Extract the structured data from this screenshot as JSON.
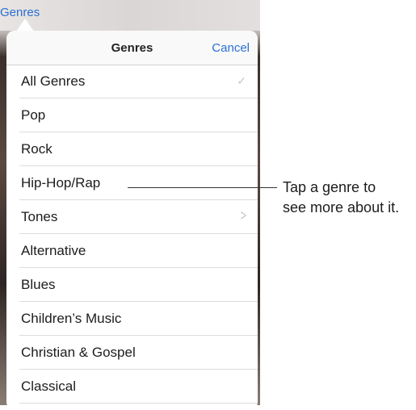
{
  "top_link": "Genres",
  "popover": {
    "title": "Genres",
    "cancel": "Cancel",
    "rows": [
      {
        "label": "All Genres",
        "accessory": "check"
      },
      {
        "label": "Pop",
        "accessory": ""
      },
      {
        "label": "Rock",
        "accessory": ""
      },
      {
        "label": "Hip-Hop/Rap",
        "accessory": ""
      },
      {
        "label": "Tones",
        "accessory": "chevron"
      },
      {
        "label": "Alternative",
        "accessory": ""
      },
      {
        "label": "Blues",
        "accessory": ""
      },
      {
        "label": "Children’s Music",
        "accessory": ""
      },
      {
        "label": "Christian & Gospel",
        "accessory": ""
      },
      {
        "label": "Classical",
        "accessory": ""
      }
    ]
  },
  "callout": {
    "line1": "Tap a genre to",
    "line2": "see more about it."
  }
}
